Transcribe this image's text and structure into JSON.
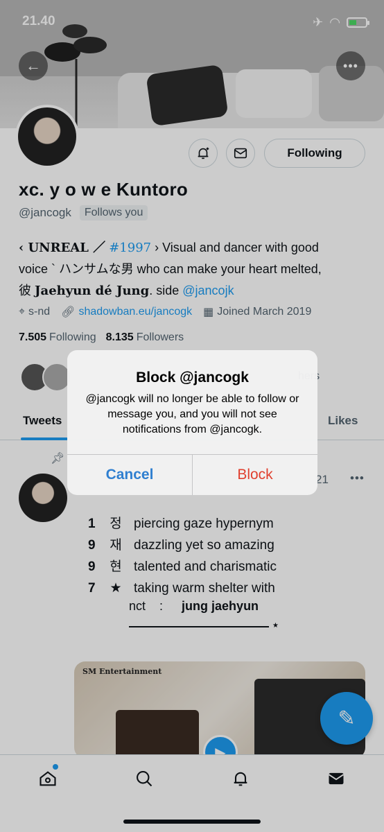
{
  "status_bar": {
    "time": "21.40"
  },
  "profile": {
    "display_name": "xc. y o w e Kuntoro",
    "handle": "@jancogk",
    "follows_you": "Follows you",
    "following_button": "Following",
    "bio": {
      "line1_prefix": "‹ UNREAL ／",
      "line1_tag": "#1997",
      "line1_suffix": "› Visual and dancer with good",
      "line2": "voice ` ハンサムな男 who can make your heart melted,",
      "line3_prefix": "彼",
      "line3_name": "Jaehyun dé Jung",
      "line3_side": ". side",
      "line3_link": "@jancojk"
    },
    "location": "s-nd",
    "website": "shadowban.eu/jancogk",
    "joined": "Joined March 2019",
    "following_count": "7.505",
    "following_label": "Following",
    "followers_count": "8.135",
    "followers_label": "Followers",
    "known_followers_tail": "hers"
  },
  "tabs": {
    "tweets": "Tweets",
    "likes": "Likes"
  },
  "tweet": {
    "date_fragment": "21",
    "lines": [
      {
        "num": "1",
        "glyph": "정",
        "text": "piercing gaze hypernym"
      },
      {
        "num": "9",
        "glyph": "재",
        "text": "dazzling yet so amazing"
      },
      {
        "num": "9",
        "glyph": "현",
        "text": "talented and charismatic"
      },
      {
        "num": "7",
        "glyph": "★",
        "text": "taking warm shelter with"
      }
    ],
    "sub_prefix": "nct    :",
    "sub_name": "jung jaehyun",
    "media_brand": "SM Entertainment"
  },
  "alert": {
    "title": "Block @jancogk",
    "message": "@jancogk will no longer be able to follow or message you, and you will not see notifications from @jancogk.",
    "cancel": "Cancel",
    "block": "Block"
  },
  "colors": {
    "accent": "#1d9bf0",
    "destructive": "#e0402f",
    "ios_blue": "#2f7fd0"
  }
}
